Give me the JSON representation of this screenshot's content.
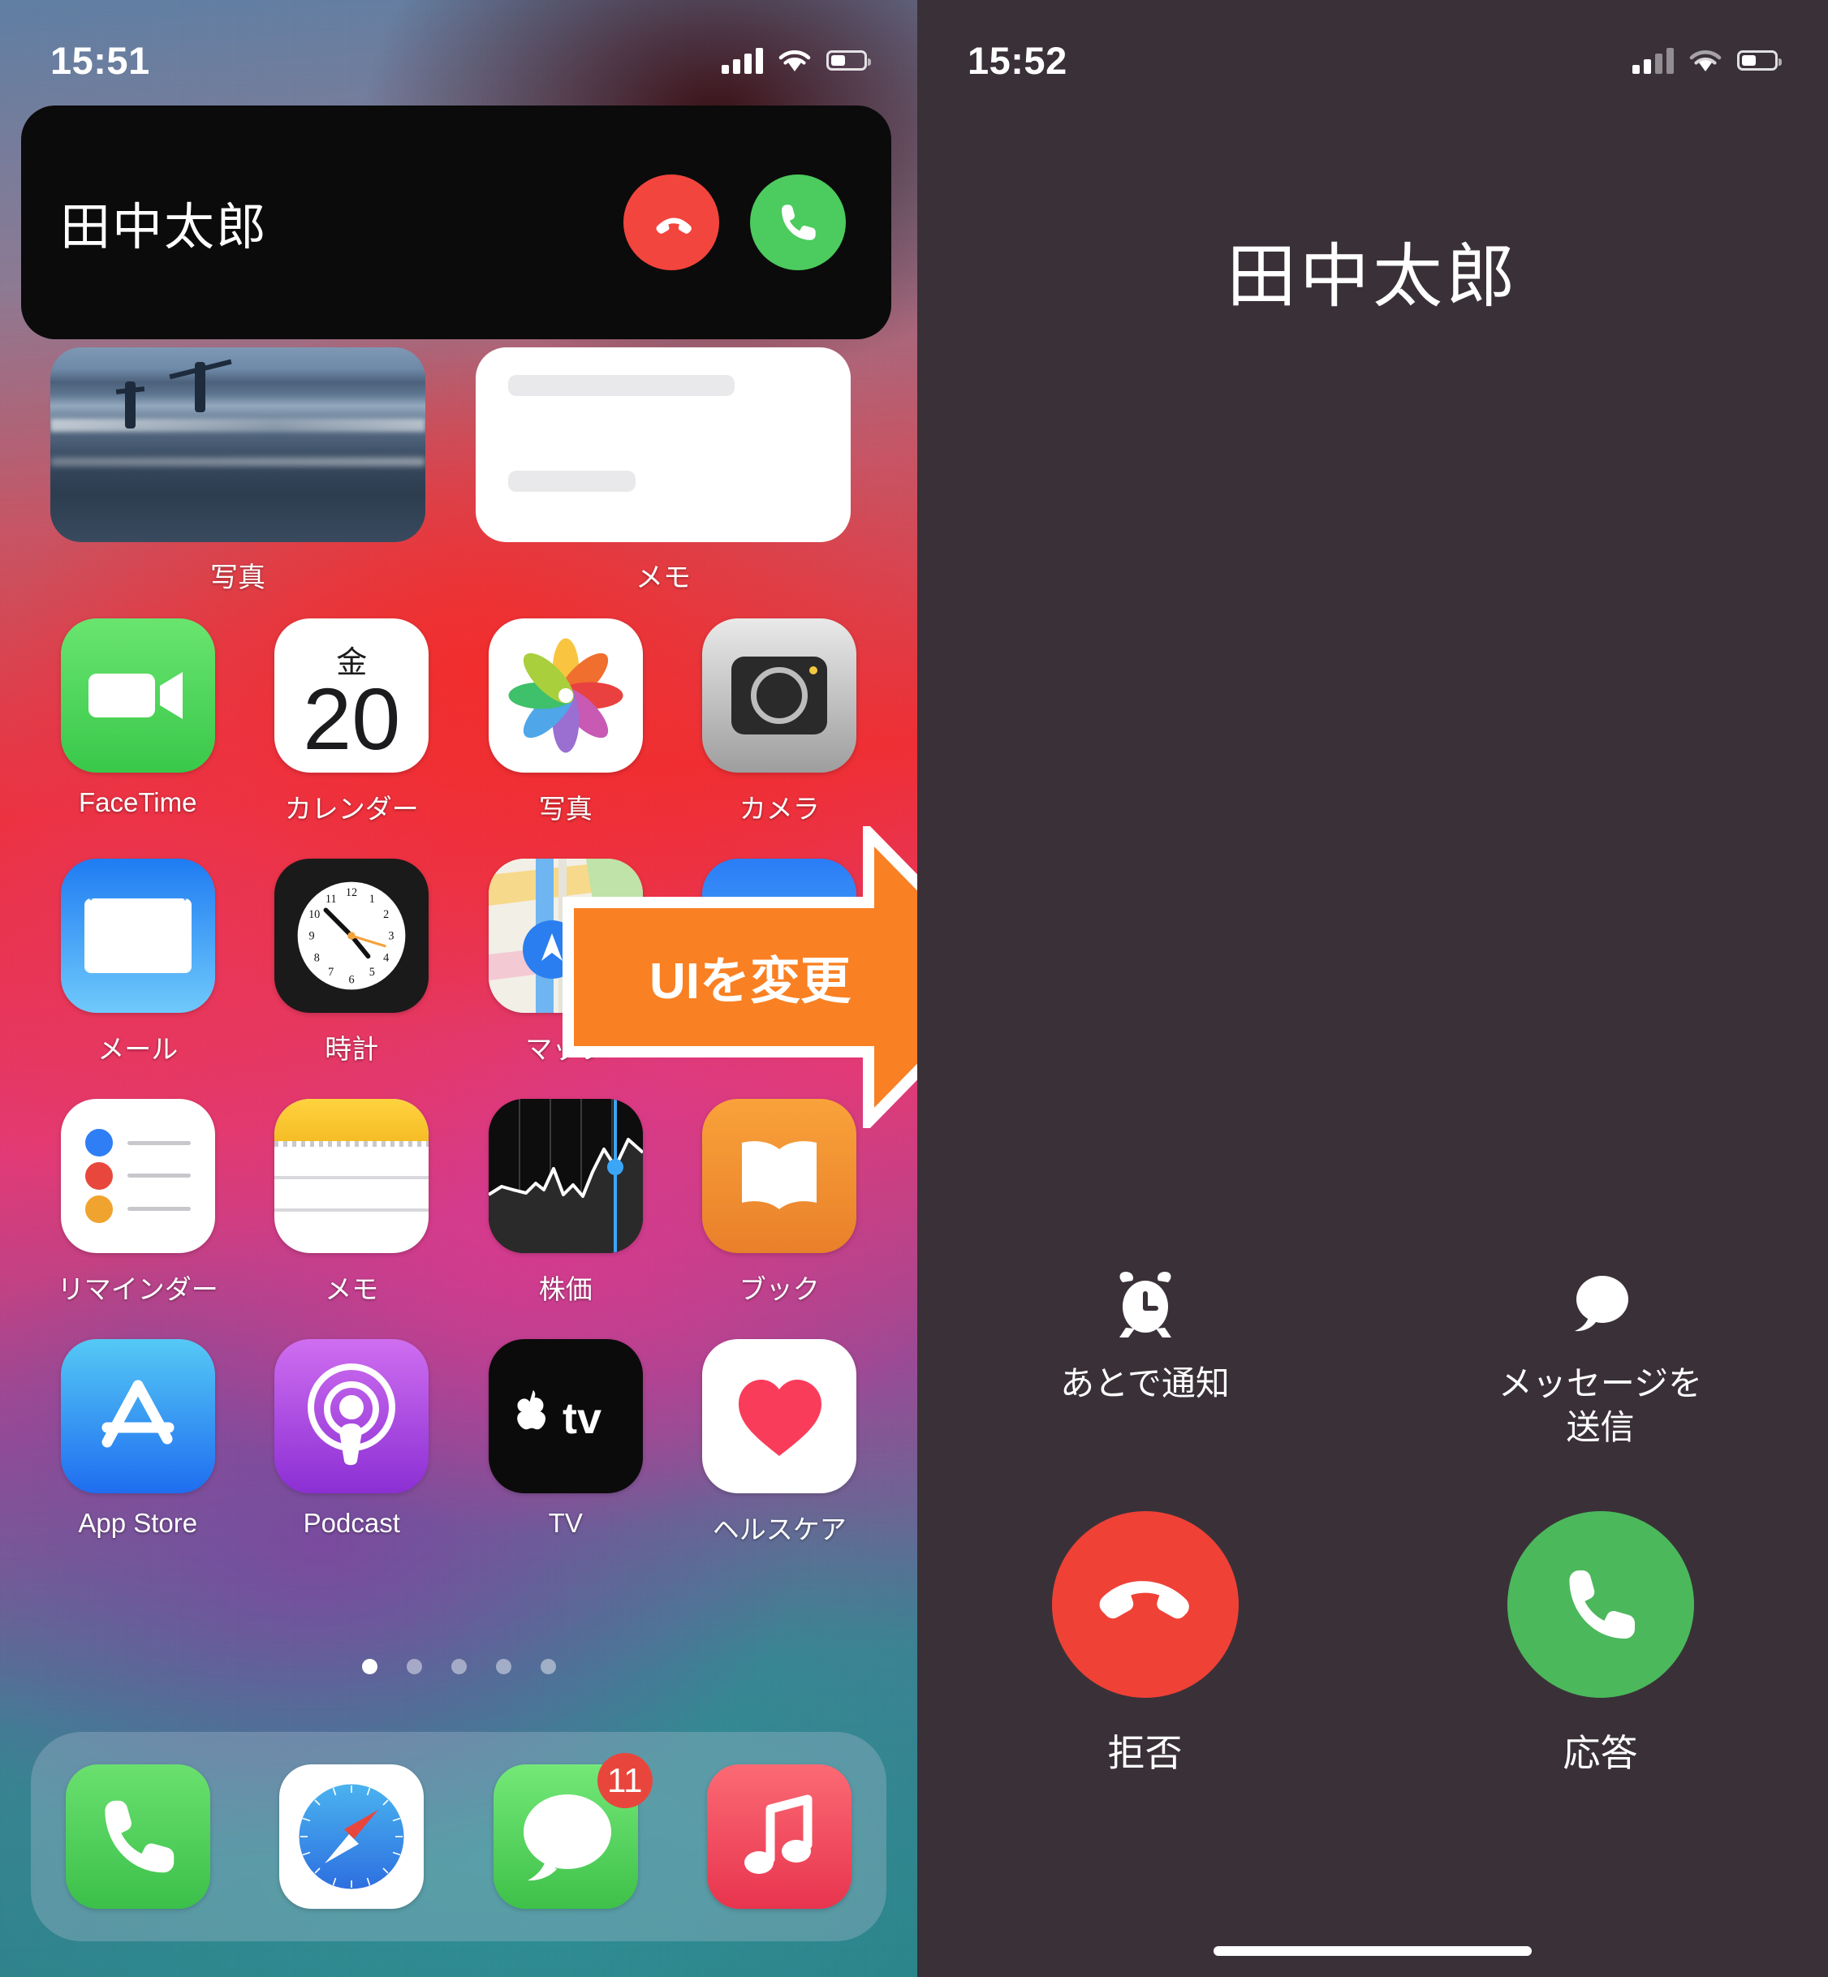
{
  "left_phone": {
    "status_bar": {
      "time": "15:51",
      "cellular_icon": "cellular-bars-icon",
      "wifi_icon": "wifi-icon",
      "battery_icon": "battery-icon"
    },
    "call_banner": {
      "caller_name": "田中太郎",
      "decline_icon": "phone-down-icon",
      "accept_icon": "phone-icon",
      "decline_color": "#f2453d",
      "accept_color": "#4ccb5e"
    },
    "widgets": [
      {
        "label": "写真",
        "icon": "photos-widget"
      },
      {
        "label": "メモ",
        "icon": "notes-widget"
      }
    ],
    "apps": [
      {
        "label": "FaceTime",
        "icon": "facetime-icon"
      },
      {
        "label": "カレンダー",
        "icon": "calendar-icon",
        "day_of_week": "金",
        "day": "20"
      },
      {
        "label": "写真",
        "icon": "photos-icon"
      },
      {
        "label": "カメラ",
        "icon": "camera-icon"
      },
      {
        "label": "メール",
        "icon": "mail-icon"
      },
      {
        "label": "時計",
        "icon": "clock-icon"
      },
      {
        "label": "マップ",
        "icon": "maps-icon"
      },
      {
        "label": "",
        "icon": "weather-icon"
      },
      {
        "label": "リマインダー",
        "icon": "reminders-icon"
      },
      {
        "label": "メモ",
        "icon": "notes-icon"
      },
      {
        "label": "株価",
        "icon": "stocks-icon"
      },
      {
        "label": "ブック",
        "icon": "books-icon"
      },
      {
        "label": "App Store",
        "icon": "appstore-icon"
      },
      {
        "label": "Podcast",
        "icon": "podcast-icon"
      },
      {
        "label": "TV",
        "icon": "tv-icon"
      },
      {
        "label": "ヘルスケア",
        "icon": "health-icon"
      }
    ],
    "page_dots": {
      "count": 5,
      "active_index": 0
    },
    "dock": [
      {
        "name": "phone",
        "icon": "phone-icon",
        "badge": ""
      },
      {
        "name": "safari",
        "icon": "safari-compass-icon",
        "badge": ""
      },
      {
        "name": "messages",
        "icon": "messages-bubble-icon",
        "badge": "11"
      },
      {
        "name": "music",
        "icon": "music-note-icon",
        "badge": ""
      }
    ]
  },
  "annotation": {
    "arrow_label": "UIを変更",
    "arrow_color": "#F98023",
    "arrow_outline": "#FFFFFF"
  },
  "right_phone": {
    "status_bar": {
      "time": "15:52",
      "cellular_icon": "cellular-bars-icon",
      "wifi_icon": "wifi-icon",
      "battery_icon": "battery-icon"
    },
    "background_color": "#3A3138",
    "caller_name": "田中太郎",
    "secondary_actions": [
      {
        "label": "あとで通知",
        "icon": "alarm-clock-icon"
      },
      {
        "label": "メッセージを\n送信",
        "label_line1": "メッセージを",
        "label_line2": "送信",
        "icon": "message-bubble-icon"
      }
    ],
    "primary_actions": [
      {
        "label": "拒否",
        "icon": "phone-down-icon",
        "color": "#EF4136"
      },
      {
        "label": "応答",
        "icon": "phone-icon",
        "color": "#4CB85C"
      }
    ],
    "home_indicator": "home-indicator"
  }
}
